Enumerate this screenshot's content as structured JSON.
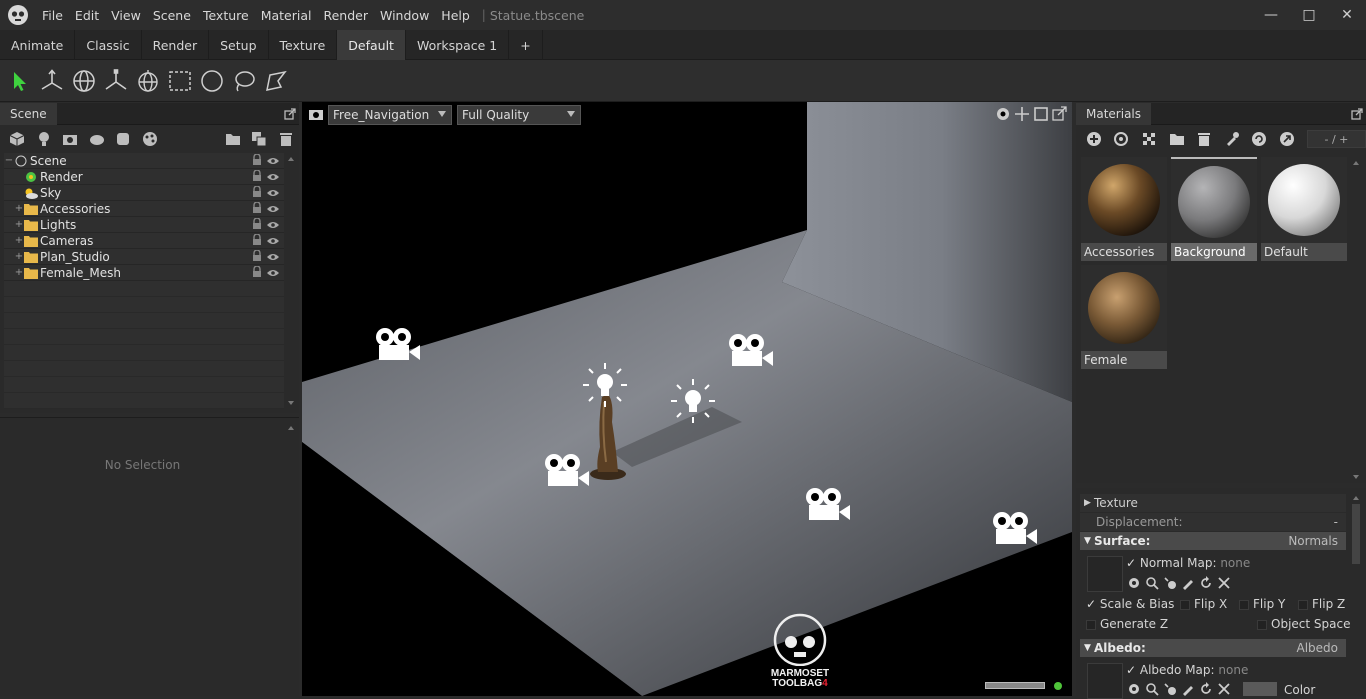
{
  "app": {
    "file_title": "Statue.tbscene"
  },
  "menu": [
    "File",
    "Edit",
    "View",
    "Scene",
    "Texture",
    "Material",
    "Render",
    "Window",
    "Help"
  ],
  "window_controls": {
    "minimize": "—",
    "maximize": "□",
    "close": "✕"
  },
  "tabs": [
    {
      "label": "Animate",
      "active": false
    },
    {
      "label": "Classic",
      "active": false
    },
    {
      "label": "Render",
      "active": false
    },
    {
      "label": "Setup",
      "active": false
    },
    {
      "label": "Texture",
      "active": false
    },
    {
      "label": "Default",
      "active": true
    },
    {
      "label": "Workspace 1",
      "active": false
    },
    {
      "label": "+",
      "active": false
    }
  ],
  "toolbar": [
    "select-arrow-icon",
    "move-gizmo-icon",
    "rotate-gizmo-icon",
    "scale-gizmo-icon",
    "world-gizmo-icon",
    "rect-select-icon",
    "circle-select-icon",
    "lasso-select-icon",
    "paint-select-icon"
  ],
  "scene_panel": {
    "title": "Scene",
    "tree": [
      {
        "label": "Scene",
        "type": "root",
        "expander": "−"
      },
      {
        "label": "Render",
        "type": "render",
        "expander": ""
      },
      {
        "label": "Sky",
        "type": "sky",
        "expander": ""
      },
      {
        "label": "Accessories",
        "type": "folder",
        "expander": "+"
      },
      {
        "label": "Lights",
        "type": "folder",
        "expander": "+"
      },
      {
        "label": "Cameras",
        "type": "folder",
        "expander": "+"
      },
      {
        "label": "Plan_Studio",
        "type": "folder",
        "expander": "+"
      },
      {
        "label": "Female_Mesh",
        "type": "folder",
        "expander": "+"
      }
    ]
  },
  "properties_panel": {
    "empty_text": "No Selection"
  },
  "viewport": {
    "camera_mode": "Free_Navigation",
    "quality": "Full Quality",
    "watermark_line1": "MARMOSET",
    "watermark_line2": "TOOLBAG",
    "watermark_version": "4",
    "status_color": "#4fc43a"
  },
  "materials_panel": {
    "title": "Materials",
    "page": "- /",
    "materials": [
      {
        "name": "Accessories",
        "kind": "rough-bronze",
        "selected": false
      },
      {
        "name": "Background",
        "kind": "grey",
        "selected": true
      },
      {
        "name": "Default",
        "kind": "white",
        "selected": false
      },
      {
        "name": "Female",
        "kind": "bronze",
        "selected": false
      }
    ]
  },
  "material_props": {
    "texture": "Texture",
    "displacement": {
      "label": "Displacement:",
      "value": "-"
    },
    "surface": {
      "label": "Surface:",
      "value": "Normals"
    },
    "normal_map": {
      "label": "Normal Map:",
      "value": "none"
    },
    "scale_bias": "Scale & Bias",
    "flip_x": "Flip X",
    "flip_y": "Flip Y",
    "flip_z": "Flip Z",
    "generate_z": "Generate Z",
    "object_space": "Object Space",
    "albedo": {
      "label": "Albedo:",
      "value": "Albedo"
    },
    "albedo_map": {
      "label": "Albedo Map:",
      "value": "none"
    },
    "color": "Color"
  }
}
